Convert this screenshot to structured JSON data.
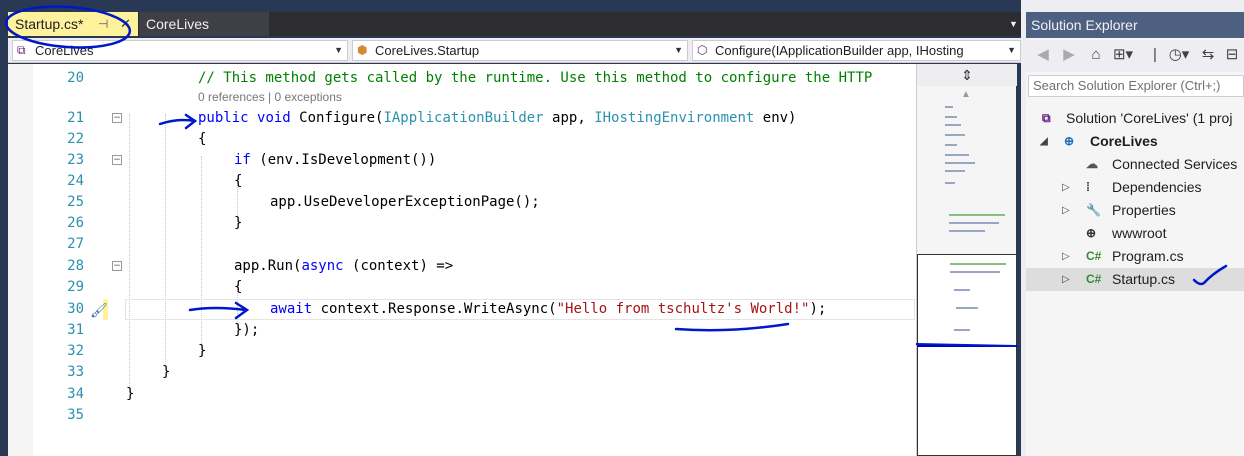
{
  "tabs": [
    {
      "label": "Startup.cs*",
      "pin": "⊣",
      "close": "✕"
    },
    {
      "label": "CoreLives"
    }
  ],
  "tab_overflow": "▼",
  "nav": {
    "project": "CoreLives",
    "class": "CoreLives.Startup",
    "member": "Configure(IApplicationBuilder app, IHosting"
  },
  "code_lens": "0 references | 0 exceptions",
  "lines": [
    {
      "n": "20",
      "text": "// This method gets called by the runtime. Use this method to configure the HTTP"
    },
    {
      "n": "21",
      "text": "public void Configure(IApplicationBuilder app, IHostingEnvironment env)"
    },
    {
      "n": "22",
      "text": "{"
    },
    {
      "n": "23",
      "text": "if (env.IsDevelopment())"
    },
    {
      "n": "24",
      "text": "{"
    },
    {
      "n": "25",
      "text": "app.UseDeveloperExceptionPage();"
    },
    {
      "n": "26",
      "text": "}"
    },
    {
      "n": "27",
      "text": ""
    },
    {
      "n": "28",
      "text": "app.Run(async (context) =>"
    },
    {
      "n": "29",
      "text": "{"
    },
    {
      "n": "30",
      "text": "await context.Response.WriteAsync(\"Hello from tschultz's World!\");"
    },
    {
      "n": "31",
      "text": "});"
    },
    {
      "n": "32",
      "text": "}"
    },
    {
      "n": "33",
      "text": "}"
    },
    {
      "n": "34",
      "text": "}"
    },
    {
      "n": "35",
      "text": ""
    }
  ],
  "solution_explorer": {
    "title": "Solution Explorer",
    "search_placeholder": "Search Solution Explorer (Ctrl+;)",
    "items": [
      {
        "label": "Solution 'CoreLives' (1 proj",
        "icon": "solution-icon"
      },
      {
        "label": "CoreLives",
        "icon": "web-project-icon"
      },
      {
        "label": "Connected Services",
        "icon": "connected-services-icon"
      },
      {
        "label": "Dependencies",
        "icon": "dependencies-icon"
      },
      {
        "label": "Properties",
        "icon": "wrench-icon"
      },
      {
        "label": "wwwroot",
        "icon": "globe-icon"
      },
      {
        "label": "Program.cs",
        "icon": "csharp-file-icon"
      },
      {
        "label": "Startup.cs",
        "icon": "csharp-file-icon"
      }
    ]
  },
  "colors": {
    "keyword": "#0000ff",
    "type": "#2b91af",
    "comment": "#008000",
    "string": "#a31515",
    "annotation_ink": "#0018c8",
    "active_tab": "#fff29d"
  }
}
